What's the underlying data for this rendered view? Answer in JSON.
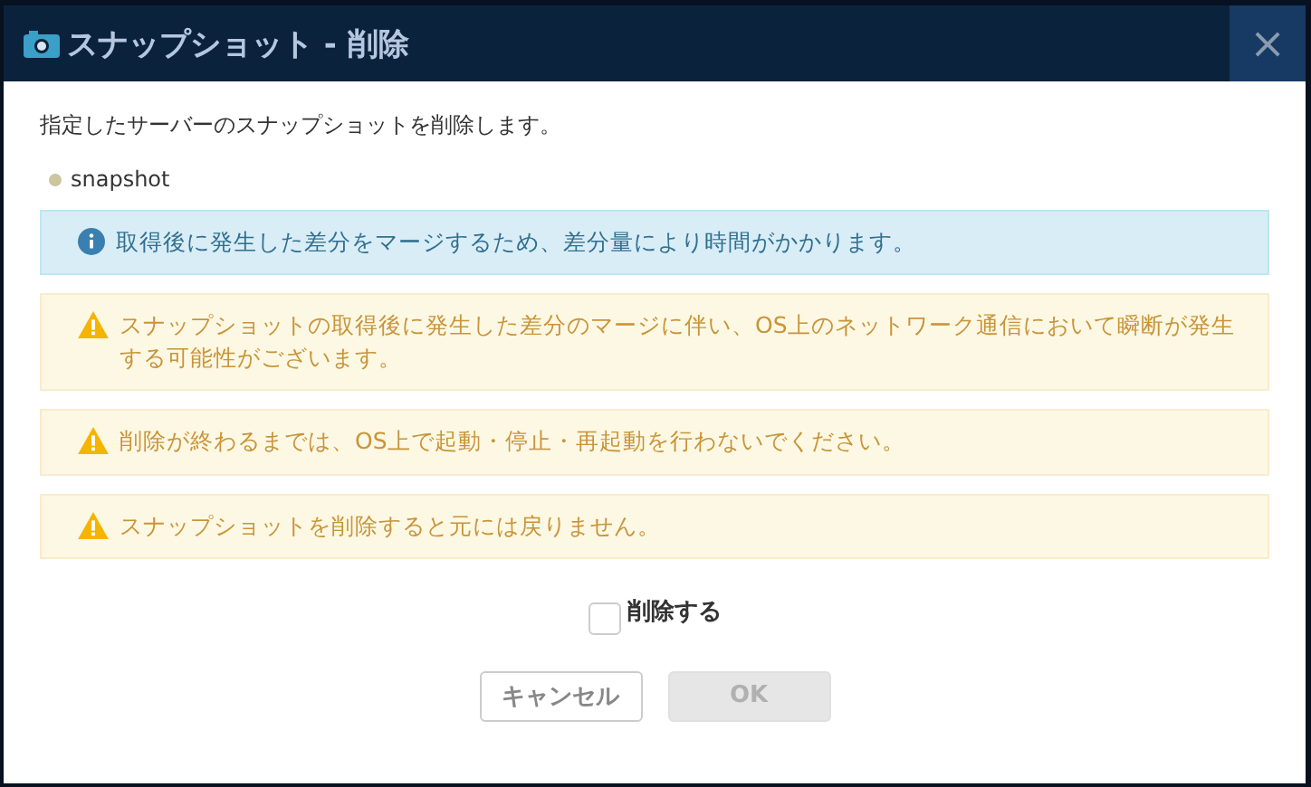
{
  "dialog": {
    "title": "スナップショット - 削除",
    "close": "×"
  },
  "message": "指定したサーバーのスナップショットを削除します。",
  "items": [
    "snapshot"
  ],
  "alerts": [
    {
      "kind": "info",
      "text": "取得後に発生した差分をマージするため、差分量により時間がかかります。"
    },
    {
      "kind": "warning",
      "text": "スナップショットの取得後に発生した差分のマージに伴い、OS上のネットワーク通信において瞬断が発生する可能性がございます。"
    },
    {
      "kind": "warning",
      "text": "削除が終わるまでは、OS上で起動・停止・再起動を行わないでください。"
    },
    {
      "kind": "warning",
      "text": "スナップショットを削除すると元には戻りません。"
    }
  ],
  "confirm": {
    "label": "削除する",
    "checked": false
  },
  "buttons": [
    {
      "label": "キャンセル",
      "disabled": false
    },
    {
      "label": "OK",
      "disabled": true
    }
  ]
}
